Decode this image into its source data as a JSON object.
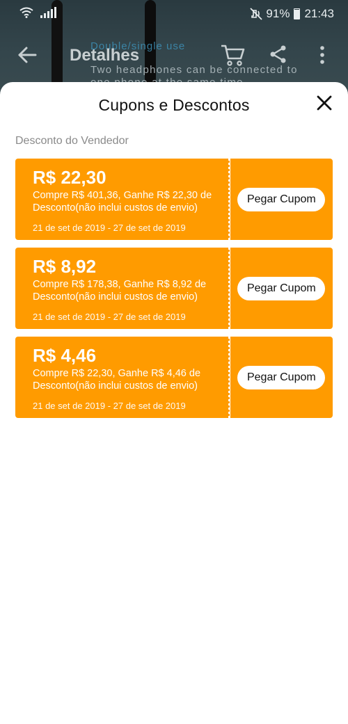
{
  "status_bar": {
    "battery": "91%",
    "time": "21:43"
  },
  "background_page": {
    "nav_title": "Detalhes",
    "overlay_line1": "Double/single   use",
    "overlay_line2": "Two headphones can be connected to",
    "overlay_line3": "one phone at the same time"
  },
  "sheet": {
    "title": "Cupons e Descontos",
    "section_label": "Desconto do Vendedor",
    "coupons": [
      {
        "amount": "R$ 22,30",
        "description": "Compre R$ 401,36, Ganhe R$ 22,30 de Desconto(não inclui custos de envio)",
        "date": "21 de set de 2019 - 27 de set de 2019",
        "button": "Pegar Cupom"
      },
      {
        "amount": "R$ 8,92",
        "description": "Compre R$ 178,38, Ganhe R$ 8,92 de Desconto(não inclui custos de envio)",
        "date": "21 de set de 2019 - 27 de set de 2019",
        "button": "Pegar Cupom"
      },
      {
        "amount": "R$ 4,46",
        "description": "Compre R$ 22,30, Ganhe R$ 4,46 de Desconto(não inclui custos de envio)",
        "date": "21 de set de 2019 - 27 de set de 2019",
        "button": "Pegar Cupom"
      }
    ]
  },
  "colors": {
    "coupon_background": "#ff9b00",
    "sheet_background": "#ffffff"
  },
  "icons": {
    "status": [
      "wifi-icon",
      "signal-icon",
      "mute-icon",
      "battery-icon"
    ],
    "nav": [
      "back-icon",
      "cart-icon",
      "share-icon",
      "more-icon"
    ],
    "sheet": [
      "close-icon"
    ]
  }
}
